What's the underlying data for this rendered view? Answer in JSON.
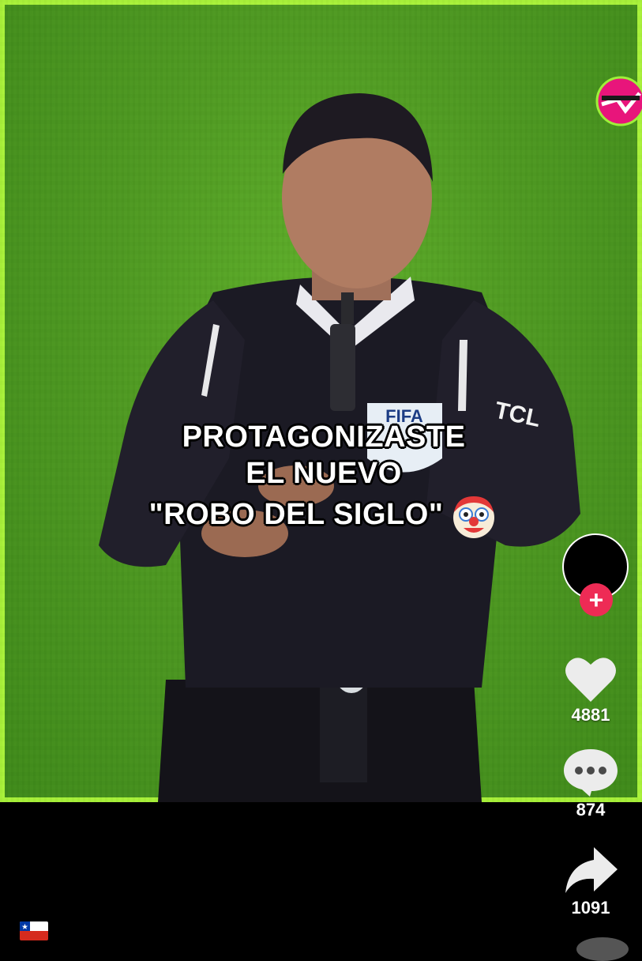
{
  "video": {
    "caption_lines": [
      "PROTAGONIZASTE",
      "EL NUEVO",
      "\"ROBO DEL SIGLO\""
    ],
    "caption_emoji": "clown-icon",
    "jersey_badge": "FIFA",
    "sleeve_text": "TCL",
    "channel_logo": "tvn-logo",
    "colors": {
      "pitch": "#4f9a22",
      "border_glow": "#a9f23a",
      "logo": "#e8157b"
    }
  },
  "sidebar": {
    "follow_label": "+",
    "likes": "4881",
    "comments": "874",
    "shares": "1091",
    "colors": {
      "follow": "#ee2b55",
      "icon": "#ffffff"
    }
  },
  "footer": {
    "flag": "chile-flag-icon"
  }
}
